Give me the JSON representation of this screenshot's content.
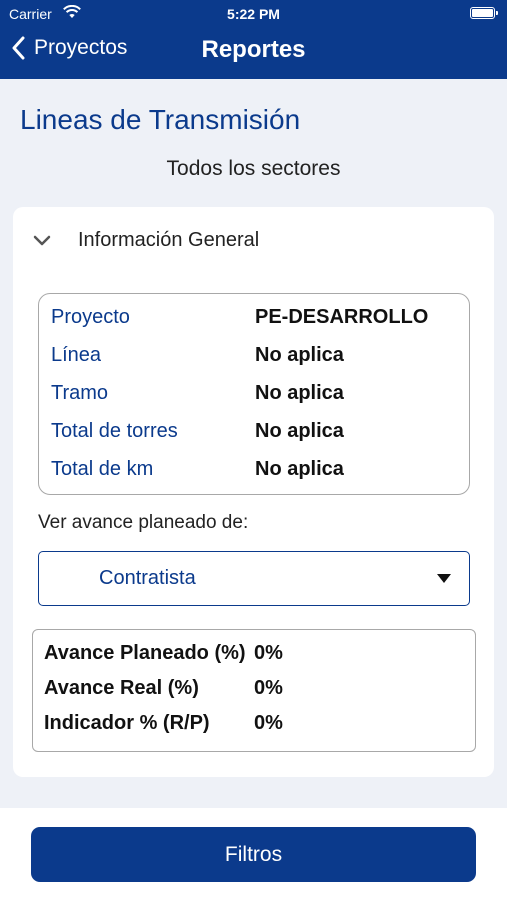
{
  "status_bar": {
    "carrier": "Carrier",
    "time": "5:22 PM"
  },
  "nav": {
    "back_label": "Proyectos",
    "title": "Reportes"
  },
  "page": {
    "title": "Lineas de Transmisión",
    "subtitle": "Todos los sectores"
  },
  "section": {
    "label": "Información General"
  },
  "info": [
    {
      "key": "Proyecto",
      "value": "PE-DESARROLLO"
    },
    {
      "key": "Línea",
      "value": "No aplica"
    },
    {
      "key": "Tramo",
      "value": "No aplica"
    },
    {
      "key": "Total de torres",
      "value": "No aplica"
    },
    {
      "key": "Total de km",
      "value": "No aplica"
    }
  ],
  "planned_view": {
    "label": "Ver avance planeado de:",
    "selected": "Contratista"
  },
  "progress": [
    {
      "key": "Avance Planeado (%)",
      "value": "0%"
    },
    {
      "key": "Avance Real (%)",
      "value": "0%"
    },
    {
      "key": "Indicador % (R/P)",
      "value": "0%"
    }
  ],
  "footer": {
    "button_label": "Filtros"
  },
  "colors": {
    "primary": "#0b3a8c",
    "background": "#eef1f7"
  }
}
